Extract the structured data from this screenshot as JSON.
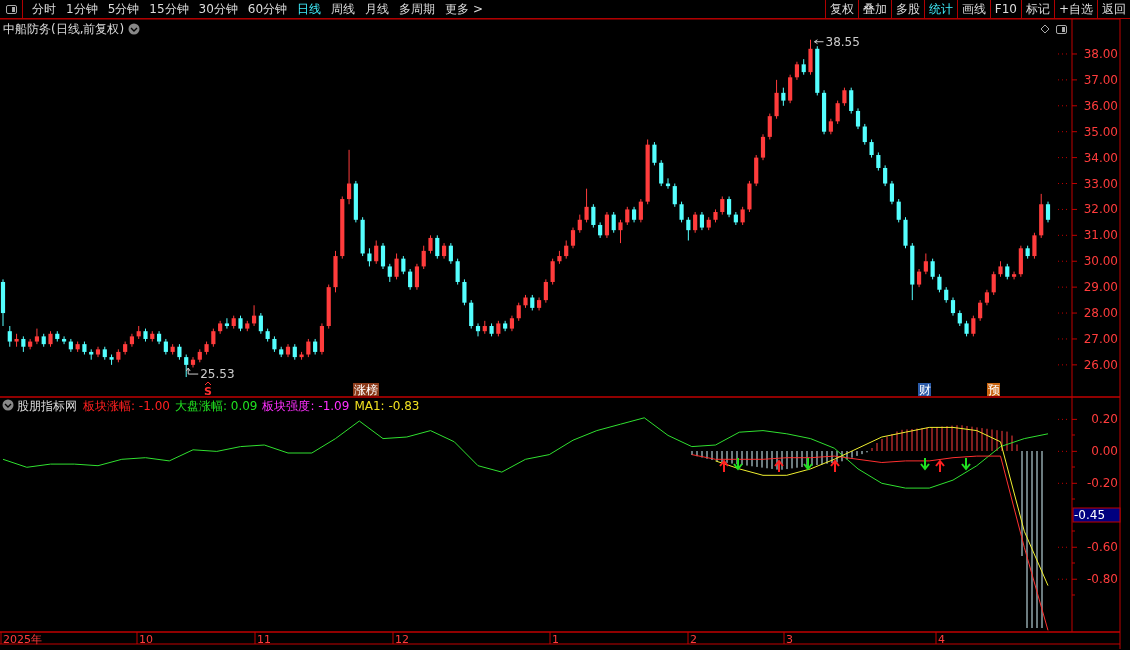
{
  "toolbar": {
    "periods": [
      {
        "label": "分时",
        "selected": false
      },
      {
        "label": "1分钟",
        "selected": false
      },
      {
        "label": "5分钟",
        "selected": false
      },
      {
        "label": "15分钟",
        "selected": false
      },
      {
        "label": "30分钟",
        "selected": false
      },
      {
        "label": "60分钟",
        "selected": false
      },
      {
        "label": "日线",
        "selected": true
      },
      {
        "label": "周线",
        "selected": false
      },
      {
        "label": "月线",
        "selected": false
      },
      {
        "label": "多周期",
        "selected": false
      },
      {
        "label": "更多 >",
        "selected": false
      }
    ],
    "actions": [
      {
        "label": "复权",
        "selected": false
      },
      {
        "label": "叠加",
        "selected": false
      },
      {
        "label": "多股",
        "selected": false
      },
      {
        "label": "统计",
        "selected": true
      },
      {
        "label": "画线",
        "selected": false
      },
      {
        "label": "F10",
        "selected": false
      },
      {
        "label": "标记",
        "selected": false
      },
      {
        "label": "+自选",
        "selected": false
      },
      {
        "label": "返回",
        "selected": false
      }
    ]
  },
  "chart": {
    "title": "中船防务(日线,前复权)",
    "high_label": "38.55",
    "low_label": "25.53",
    "markers": [
      {
        "label": "S",
        "kind": "signal",
        "color": "#ff3030"
      },
      {
        "label": "涨榜",
        "kind": "tag",
        "color": "#8b3a1a"
      },
      {
        "label": "财",
        "kind": "tag",
        "color": "#2a5aa8"
      },
      {
        "label": "预",
        "kind": "tag",
        "color": "#c86410"
      }
    ],
    "chart_data": {
      "type": "candlestick",
      "ylim": [
        24.76,
        39.35
      ],
      "categories": [
        null,
        null,
        null,
        null,
        null,
        null,
        null,
        null,
        null,
        null,
        null,
        null,
        null,
        null,
        null,
        null,
        null,
        null,
        null,
        null,
        null,
        null,
        null,
        null,
        null,
        null,
        null,
        null,
        null,
        null,
        null,
        null,
        null,
        null,
        null,
        null,
        null,
        null,
        null,
        null,
        null,
        null,
        null,
        null,
        null,
        null,
        null,
        null,
        null,
        null,
        null,
        null,
        null,
        null,
        null,
        null,
        null,
        null,
        null,
        null,
        null,
        null,
        null,
        null,
        null,
        null,
        null,
        null,
        null,
        null,
        null,
        null,
        null,
        null,
        null,
        null,
        null,
        null,
        null,
        null,
        null,
        null,
        null,
        null,
        null,
        null,
        null,
        null,
        null,
        null,
        null,
        null,
        null,
        null,
        null,
        null,
        null,
        null,
        null,
        null,
        null,
        null,
        null,
        null,
        null,
        null,
        null,
        null,
        null,
        null,
        null,
        null,
        null,
        null,
        null,
        null,
        null,
        null,
        null,
        null,
        null,
        null,
        null,
        null,
        null,
        null,
        null,
        null,
        null,
        null,
        null,
        null,
        null,
        null,
        null,
        null,
        null,
        null,
        null,
        null,
        null,
        null,
        null,
        null,
        null,
        null,
        null,
        null,
        null,
        null,
        null,
        null,
        null,
        null,
        null
      ],
      "yticks": [
        {
          "value": 38,
          "label": "38.00"
        },
        {
          "value": 37,
          "label": "37.00"
        },
        {
          "value": 36,
          "label": "36.00"
        },
        {
          "value": 35,
          "label": "35.00"
        },
        {
          "value": 34,
          "label": "34.00"
        },
        {
          "value": 33,
          "label": "33.00"
        },
        {
          "value": 32,
          "label": "32.00"
        },
        {
          "value": 31,
          "label": "31.00"
        },
        {
          "value": 30,
          "label": "30.00"
        },
        {
          "value": 29,
          "label": "29.00"
        },
        {
          "value": 28,
          "label": "28.00"
        },
        {
          "value": 27,
          "label": "27.00"
        },
        {
          "value": 26,
          "label": "26.00"
        }
      ],
      "ohlc": [
        [
          29.2,
          29.3,
          27.5,
          28.0
        ],
        [
          27.3,
          27.5,
          26.7,
          26.9
        ],
        [
          26.9,
          27.2,
          26.7,
          27.0
        ],
        [
          27.0,
          27.1,
          26.5,
          26.7
        ],
        [
          26.7,
          27.0,
          26.6,
          26.9
        ],
        [
          26.9,
          27.4,
          26.8,
          27.1
        ],
        [
          27.1,
          27.2,
          26.7,
          26.8
        ],
        [
          26.8,
          27.3,
          26.7,
          27.2
        ],
        [
          27.2,
          27.3,
          26.9,
          27.0
        ],
        [
          27.0,
          27.1,
          26.8,
          26.9
        ],
        [
          26.9,
          27.0,
          26.5,
          26.6
        ],
        [
          26.6,
          26.9,
          26.5,
          26.8
        ],
        [
          26.8,
          26.9,
          26.4,
          26.5
        ],
        [
          26.5,
          26.6,
          26.2,
          26.4
        ],
        [
          26.4,
          26.7,
          26.3,
          26.6
        ],
        [
          26.6,
          26.7,
          26.2,
          26.3
        ],
        [
          26.3,
          26.4,
          26.0,
          26.2
        ],
        [
          26.2,
          26.6,
          26.1,
          26.5
        ],
        [
          26.5,
          26.9,
          26.4,
          26.8
        ],
        [
          26.8,
          27.2,
          26.7,
          27.1
        ],
        [
          27.1,
          27.5,
          27.0,
          27.3
        ],
        [
          27.3,
          27.4,
          26.9,
          27.0
        ],
        [
          27.0,
          27.3,
          26.9,
          27.2
        ],
        [
          27.2,
          27.3,
          26.8,
          26.9
        ],
        [
          26.9,
          27.0,
          26.4,
          26.5
        ],
        [
          26.5,
          26.8,
          26.4,
          26.7
        ],
        [
          26.7,
          26.8,
          26.2,
          26.3
        ],
        [
          26.3,
          26.4,
          25.53,
          26.0
        ],
        [
          26.0,
          26.3,
          25.9,
          26.2
        ],
        [
          26.2,
          26.6,
          26.1,
          26.5
        ],
        [
          26.5,
          26.9,
          26.4,
          26.8
        ],
        [
          26.8,
          27.4,
          26.7,
          27.3
        ],
        [
          27.3,
          27.7,
          27.2,
          27.6
        ],
        [
          27.6,
          27.8,
          27.4,
          27.5
        ],
        [
          27.5,
          27.9,
          27.4,
          27.8
        ],
        [
          27.8,
          27.9,
          27.3,
          27.4
        ],
        [
          27.4,
          27.7,
          27.3,
          27.6
        ],
        [
          27.6,
          28.3,
          27.5,
          27.9
        ],
        [
          27.9,
          28.0,
          27.2,
          27.3
        ],
        [
          27.3,
          27.4,
          26.9,
          27.0
        ],
        [
          27.0,
          27.1,
          26.5,
          26.6
        ],
        [
          26.6,
          26.7,
          26.3,
          26.4
        ],
        [
          26.4,
          26.8,
          26.3,
          26.7
        ],
        [
          26.7,
          26.8,
          26.2,
          26.3
        ],
        [
          26.3,
          26.5,
          26.2,
          26.4
        ],
        [
          26.4,
          27.0,
          26.3,
          26.9
        ],
        [
          26.9,
          27.0,
          26.4,
          26.5
        ],
        [
          26.5,
          27.6,
          26.4,
          27.5
        ],
        [
          27.5,
          29.1,
          27.4,
          29.0
        ],
        [
          29.0,
          30.4,
          28.8,
          30.2
        ],
        [
          30.2,
          32.5,
          30.1,
          32.4
        ],
        [
          32.4,
          34.3,
          32.2,
          33.0
        ],
        [
          33.0,
          33.1,
          31.5,
          31.6
        ],
        [
          31.6,
          31.7,
          30.2,
          30.3
        ],
        [
          30.3,
          30.5,
          29.8,
          30.0
        ],
        [
          30.0,
          30.8,
          29.9,
          30.6
        ],
        [
          30.6,
          30.7,
          29.7,
          29.8
        ],
        [
          29.8,
          29.9,
          29.2,
          29.4
        ],
        [
          29.4,
          30.3,
          29.3,
          30.1
        ],
        [
          30.1,
          30.2,
          29.5,
          29.6
        ],
        [
          29.6,
          29.7,
          28.9,
          29.0
        ],
        [
          29.0,
          29.9,
          28.9,
          29.8
        ],
        [
          29.8,
          30.6,
          29.7,
          30.4
        ],
        [
          30.4,
          31.0,
          30.3,
          30.9
        ],
        [
          30.9,
          31.0,
          30.1,
          30.2
        ],
        [
          30.2,
          30.7,
          30.1,
          30.6
        ],
        [
          30.6,
          30.7,
          29.9,
          30.0
        ],
        [
          30.0,
          30.1,
          29.1,
          29.2
        ],
        [
          29.2,
          29.3,
          28.3,
          28.4
        ],
        [
          28.4,
          28.5,
          27.4,
          27.5
        ],
        [
          27.5,
          27.6,
          27.1,
          27.3
        ],
        [
          27.3,
          27.7,
          27.2,
          27.5
        ],
        [
          27.5,
          27.6,
          27.1,
          27.2
        ],
        [
          27.2,
          27.7,
          27.1,
          27.6
        ],
        [
          27.6,
          27.7,
          27.3,
          27.4
        ],
        [
          27.4,
          27.9,
          27.3,
          27.8
        ],
        [
          27.8,
          28.4,
          27.7,
          28.3
        ],
        [
          28.3,
          28.7,
          28.2,
          28.6
        ],
        [
          28.6,
          28.7,
          28.1,
          28.2
        ],
        [
          28.2,
          28.6,
          28.1,
          28.5
        ],
        [
          28.5,
          29.3,
          28.4,
          29.2
        ],
        [
          29.2,
          30.1,
          29.1,
          30.0
        ],
        [
          30.0,
          30.4,
          29.9,
          30.2
        ],
        [
          30.2,
          30.8,
          30.1,
          30.6
        ],
        [
          30.6,
          31.3,
          30.5,
          31.2
        ],
        [
          31.2,
          31.8,
          31.1,
          31.6
        ],
        [
          31.6,
          32.8,
          31.5,
          32.1
        ],
        [
          32.1,
          32.2,
          31.3,
          31.4
        ],
        [
          31.4,
          31.5,
          30.9,
          31.0
        ],
        [
          31.0,
          31.9,
          30.9,
          31.8
        ],
        [
          31.8,
          31.9,
          31.1,
          31.2
        ],
        [
          31.2,
          31.6,
          30.7,
          31.5
        ],
        [
          31.5,
          32.1,
          31.4,
          32.0
        ],
        [
          32.0,
          32.1,
          31.5,
          31.6
        ],
        [
          31.6,
          32.4,
          31.5,
          32.3
        ],
        [
          32.3,
          34.7,
          32.2,
          34.5
        ],
        [
          34.5,
          34.6,
          33.7,
          33.8
        ],
        [
          33.8,
          33.9,
          32.9,
          33.0
        ],
        [
          33.0,
          33.2,
          32.8,
          32.9
        ],
        [
          32.9,
          33.0,
          32.1,
          32.2
        ],
        [
          32.2,
          32.3,
          31.5,
          31.6
        ],
        [
          31.6,
          31.7,
          30.8,
          31.2
        ],
        [
          31.2,
          31.9,
          31.1,
          31.8
        ],
        [
          31.8,
          31.9,
          31.2,
          31.3
        ],
        [
          31.3,
          31.7,
          31.2,
          31.6
        ],
        [
          31.6,
          32.0,
          31.5,
          31.9
        ],
        [
          31.9,
          32.5,
          31.8,
          32.4
        ],
        [
          32.4,
          32.5,
          31.7,
          31.8
        ],
        [
          31.8,
          31.9,
          31.4,
          31.5
        ],
        [
          31.5,
          32.1,
          31.4,
          32.0
        ],
        [
          32.0,
          33.1,
          31.9,
          33.0
        ],
        [
          33.0,
          34.1,
          32.9,
          34.0
        ],
        [
          34.0,
          34.9,
          33.9,
          34.8
        ],
        [
          34.8,
          35.7,
          34.7,
          35.6
        ],
        [
          35.6,
          37.0,
          35.5,
          36.5
        ],
        [
          36.5,
          36.7,
          36.0,
          36.2
        ],
        [
          36.2,
          37.2,
          36.1,
          37.1
        ],
        [
          37.1,
          37.7,
          37.0,
          37.6
        ],
        [
          37.6,
          37.8,
          37.2,
          37.3
        ],
        [
          37.3,
          38.55,
          37.2,
          38.2
        ],
        [
          38.2,
          38.3,
          36.4,
          36.5
        ],
        [
          36.5,
          36.6,
          34.9,
          35.0
        ],
        [
          35.0,
          35.5,
          34.9,
          35.4
        ],
        [
          35.4,
          36.2,
          35.3,
          36.1
        ],
        [
          36.1,
          36.7,
          36.0,
          36.6
        ],
        [
          36.6,
          36.7,
          35.7,
          35.8
        ],
        [
          35.8,
          35.9,
          35.1,
          35.2
        ],
        [
          35.2,
          35.3,
          34.5,
          34.6
        ],
        [
          34.6,
          34.7,
          34.0,
          34.1
        ],
        [
          34.1,
          34.2,
          33.5,
          33.6
        ],
        [
          33.6,
          33.7,
          32.9,
          33.0
        ],
        [
          33.0,
          33.1,
          32.2,
          32.3
        ],
        [
          32.3,
          32.4,
          31.5,
          31.6
        ],
        [
          31.6,
          31.7,
          30.5,
          30.6
        ],
        [
          30.6,
          30.7,
          28.5,
          29.1
        ],
        [
          29.1,
          29.7,
          29.0,
          29.6
        ],
        [
          29.6,
          30.3,
          29.5,
          30.0
        ],
        [
          30.0,
          30.1,
          29.3,
          29.4
        ],
        [
          29.4,
          29.5,
          28.8,
          28.9
        ],
        [
          28.9,
          29.0,
          28.4,
          28.5
        ],
        [
          28.5,
          28.6,
          27.9,
          28.0
        ],
        [
          28.0,
          28.1,
          27.5,
          27.6
        ],
        [
          27.6,
          27.7,
          27.1,
          27.2
        ],
        [
          27.2,
          27.9,
          27.1,
          27.8
        ],
        [
          27.8,
          28.5,
          27.7,
          28.4
        ],
        [
          28.4,
          28.9,
          28.3,
          28.8
        ],
        [
          28.8,
          29.6,
          28.7,
          29.5
        ],
        [
          29.5,
          30.0,
          29.4,
          29.8
        ],
        [
          29.8,
          29.9,
          29.3,
          29.4
        ],
        [
          29.4,
          29.6,
          29.3,
          29.5
        ],
        [
          29.5,
          30.6,
          29.4,
          30.5
        ],
        [
          30.5,
          30.6,
          30.1,
          30.2
        ],
        [
          30.2,
          31.1,
          30.1,
          31.0
        ],
        [
          31.0,
          32.6,
          30.9,
          32.2
        ],
        [
          32.2,
          32.3,
          31.5,
          31.6
        ]
      ]
    }
  },
  "date_axis": [
    "2025年",
    "10",
    "11",
    "12",
    "1",
    "2",
    "3",
    "4"
  ],
  "indicator": {
    "name": "股朋指标网",
    "legend": [
      {
        "label": "板块涨幅: -1.00",
        "color": "#ff2020"
      },
      {
        "label": "大盘涨幅: 0.09",
        "color": "#20e020"
      },
      {
        "label": "板块强度: -1.09",
        "color": "#ff30ff"
      },
      {
        "label": "MA1: -0.83",
        "color": "#f0e020"
      }
    ],
    "cursor_value": "-0.45",
    "chart_data": {
      "type": "line",
      "ylim": [
        -1.13,
        0.34
      ],
      "categories": [
        null,
        null,
        null,
        null,
        null,
        null,
        null,
        null,
        null,
        null,
        null,
        null,
        null,
        null,
        null,
        null,
        null,
        null,
        null,
        null,
        null,
        null,
        null,
        null,
        null,
        null,
        null,
        null,
        null,
        null,
        null,
        null,
        null,
        null,
        null,
        null,
        null,
        null,
        null,
        null,
        null,
        null,
        null,
        null,
        null
      ],
      "yticks": [
        {
          "value": 0.2,
          "label": "0.20"
        },
        {
          "value": 0,
          "label": "0.00"
        },
        {
          "value": -0.2,
          "label": "-0.20"
        },
        {
          "value": -0.6,
          "label": "-0.60"
        },
        {
          "value": -0.8,
          "label": "-0.80"
        }
      ],
      "series": [
        {
          "color": "#30e030",
          "values": [
            -0.05,
            -0.1,
            -0.08,
            -0.08,
            -0.09,
            -0.05,
            -0.04,
            -0.06,
            0.01,
            0,
            0.03,
            0.04,
            -0.01,
            -0.01,
            0.08,
            0.19,
            0.08,
            0.09,
            0.13,
            0.06,
            -0.09,
            -0.13,
            -0.05,
            -0.02,
            0.07,
            0.13,
            0.17,
            0.21,
            0.1,
            0.03,
            0.04,
            0.12,
            0.13,
            0.11,
            0.08,
            0.02,
            -0.11,
            -0.2,
            -0.23,
            -0.23,
            -0.18,
            -0.09,
            0.03,
            0.08,
            0.11
          ]
        },
        {
          "color": "#ff3030",
          "values": [
            null,
            null,
            null,
            null,
            null,
            null,
            null,
            null,
            null,
            null,
            null,
            null,
            null,
            null,
            null,
            null,
            null,
            null,
            null,
            null,
            null,
            null,
            null,
            null,
            null,
            null,
            null,
            null,
            null,
            -0.02,
            -0.05,
            -0.05,
            -0.05,
            -0.04,
            -0.04,
            -0.03,
            -0.05,
            -0.07,
            -0.06,
            -0.06,
            -0.04,
            -0.03,
            -0.03,
            -0.6,
            -1.12
          ]
        },
        {
          "color": "#f0f030",
          "values": [
            null,
            null,
            null,
            null,
            null,
            null,
            null,
            null,
            null,
            null,
            null,
            null,
            null,
            null,
            null,
            null,
            null,
            null,
            null,
            null,
            null,
            null,
            null,
            null,
            null,
            null,
            null,
            null,
            null,
            null,
            -0.06,
            -0.11,
            -0.15,
            -0.15,
            -0.11,
            -0.05,
            0.02,
            0.09,
            0.12,
            0.15,
            0.15,
            0.13,
            0.06,
            -0.5,
            -0.84
          ]
        }
      ]
    }
  }
}
